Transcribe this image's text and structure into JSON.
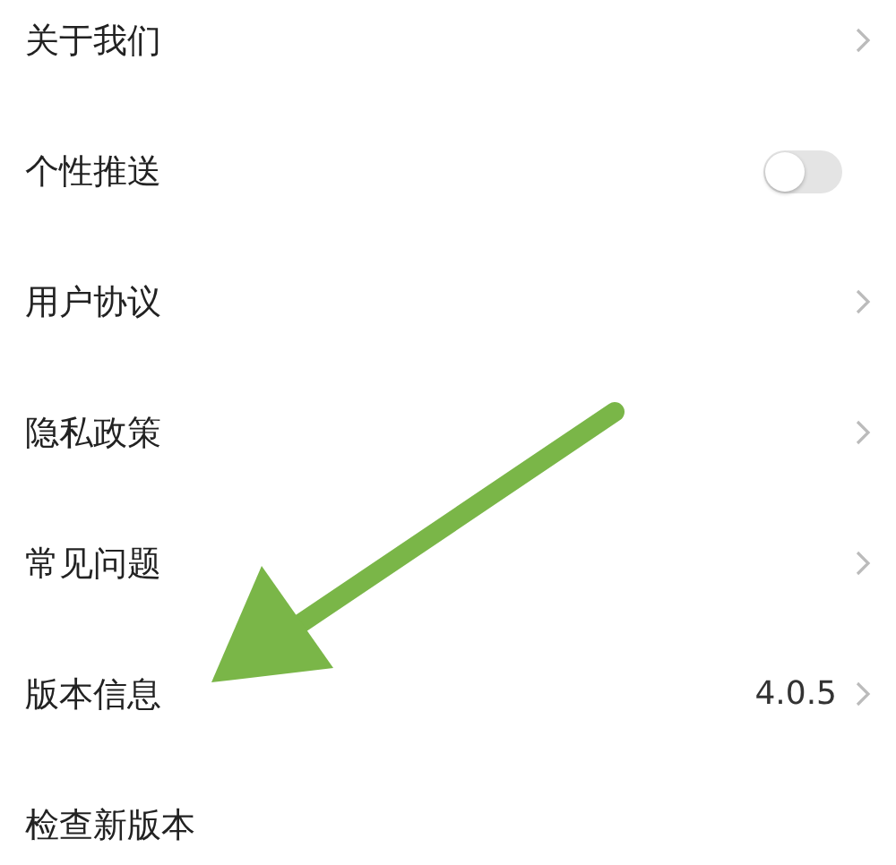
{
  "settings": [
    {
      "kind": "link",
      "label": "关于我们"
    },
    {
      "kind": "toggle",
      "label": "个性推送",
      "on": false
    },
    {
      "kind": "link",
      "label": "用户协议"
    },
    {
      "kind": "link",
      "label": "隐私政策"
    },
    {
      "kind": "link",
      "label": "常见问题"
    },
    {
      "kind": "link",
      "label": "版本信息",
      "value": "4.0.5"
    },
    {
      "kind": "plain",
      "label": "检查新版本"
    }
  ]
}
